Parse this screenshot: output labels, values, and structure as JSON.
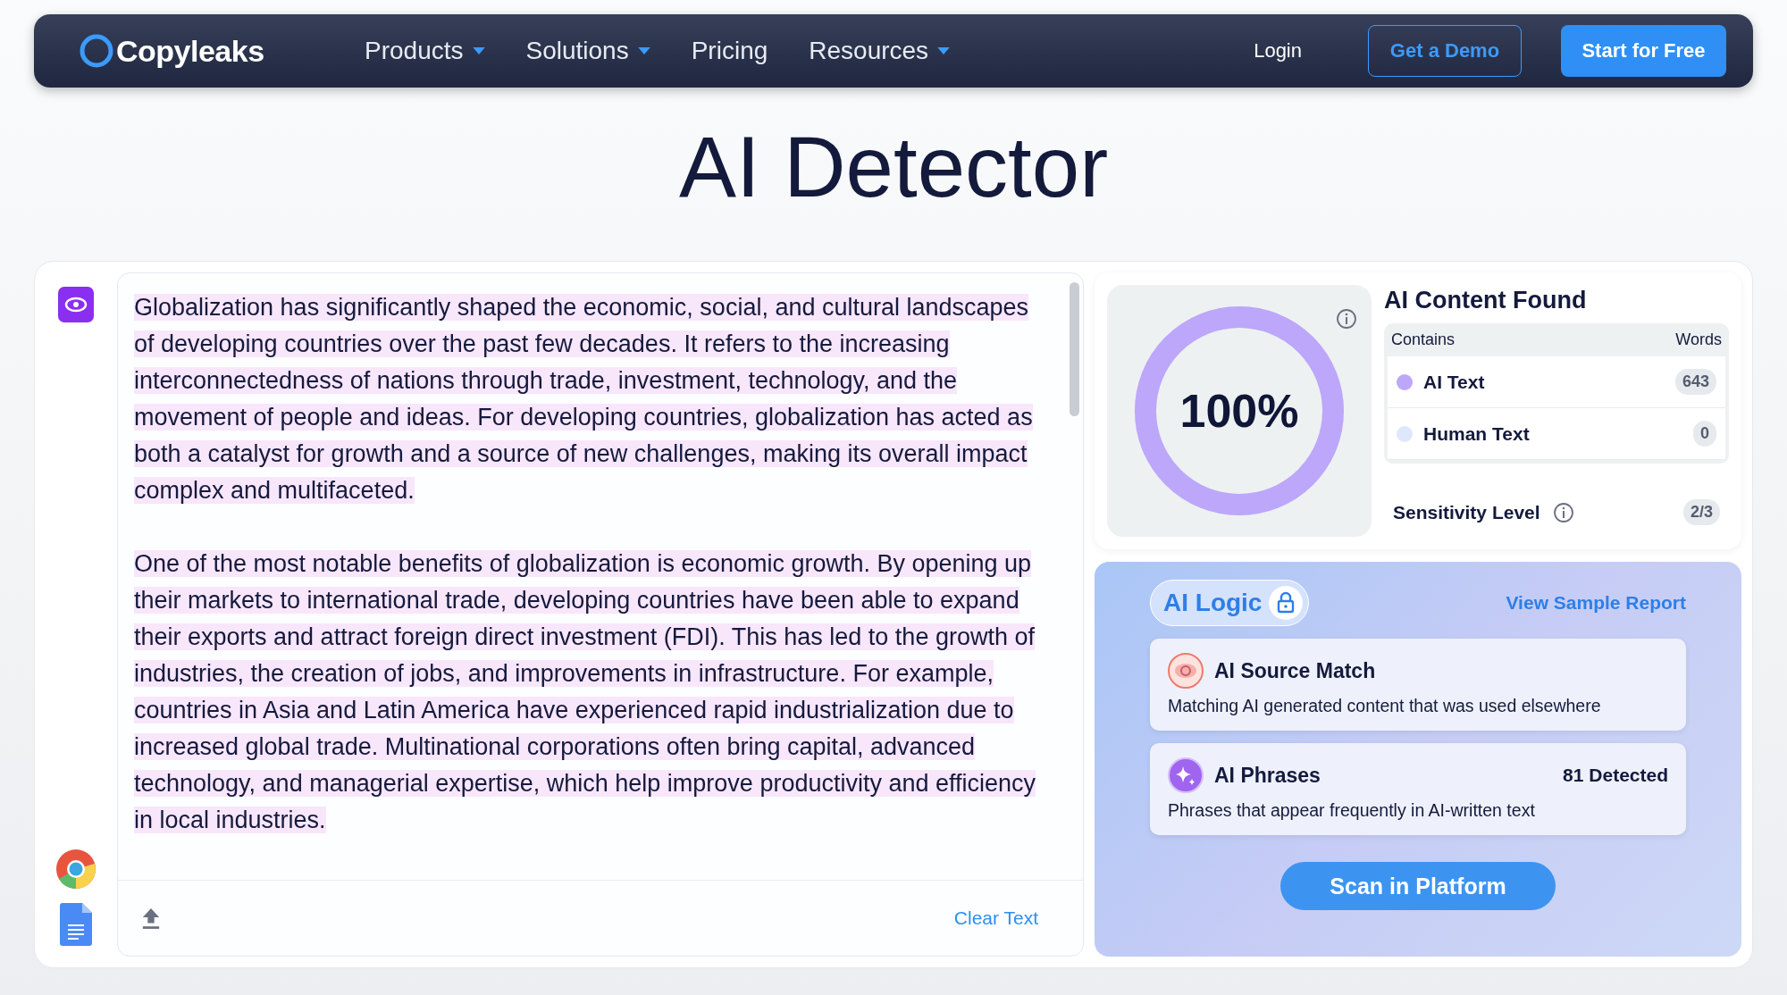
{
  "nav": {
    "logo": "Copyleaks",
    "items": [
      {
        "label": "Products",
        "has_menu": true
      },
      {
        "label": "Solutions",
        "has_menu": true
      },
      {
        "label": "Pricing",
        "has_menu": false
      },
      {
        "label": "Resources",
        "has_menu": true
      }
    ],
    "login": "Login",
    "demo": "Get a Demo",
    "start": "Start for Free"
  },
  "title": "AI Detector",
  "editor": {
    "paragraphs": [
      {
        "text": "Globalization has significantly shaped the economic, social, and cultural landscapes of developing countries over the past few decades. It refers to the increasing interconnectedness of nations through trade, investment, technology, and the movement of people and ideas. For developing countries, globalization has acted as both a catalyst for growth and a source of new challenges, making its overall impact complex and multifaceted.",
        "ai_detected": true
      },
      {
        "text": "One of the most notable benefits of globalization is economic growth. By opening up their markets to international trade, developing countries have been able to expand their exports and attract foreign direct investment (FDI). This has led to the growth of industries, the creation of jobs, and improvements in infrastructure. For example, countries in Asia and Latin America have experienced rapid industrialization due to increased global trade. Multinational corporations often bring capital, advanced technology, and managerial expertise, which help improve productivity and efficiency in local industries.",
        "ai_detected": true
      }
    ],
    "clear": "Clear Text"
  },
  "result": {
    "gauge": {
      "reading": "100%",
      "level": 1
    },
    "heading": "AI Content Found",
    "columns": [
      "Contains",
      "Words"
    ],
    "rows": [
      {
        "label": "AI Text",
        "count": "643",
        "color": "#bca7fb"
      },
      {
        "label": "Human Text",
        "count": "0",
        "color": "#dfe8fb"
      }
    ],
    "sensitivity": {
      "label": "Sensitivity Level",
      "value": "2/3"
    }
  },
  "logic": {
    "badge": "AI Logic",
    "link": "View Sample Report",
    "features": [
      {
        "kind": "source",
        "title": "AI Source Match",
        "description": "Matching AI generated content that was used elsewhere"
      },
      {
        "kind": "phrases",
        "title": "AI Phrases",
        "count": "81 Detected",
        "description": "Phrases that appear frequently in AI-written text"
      }
    ],
    "button": "Scan in Platform"
  }
}
